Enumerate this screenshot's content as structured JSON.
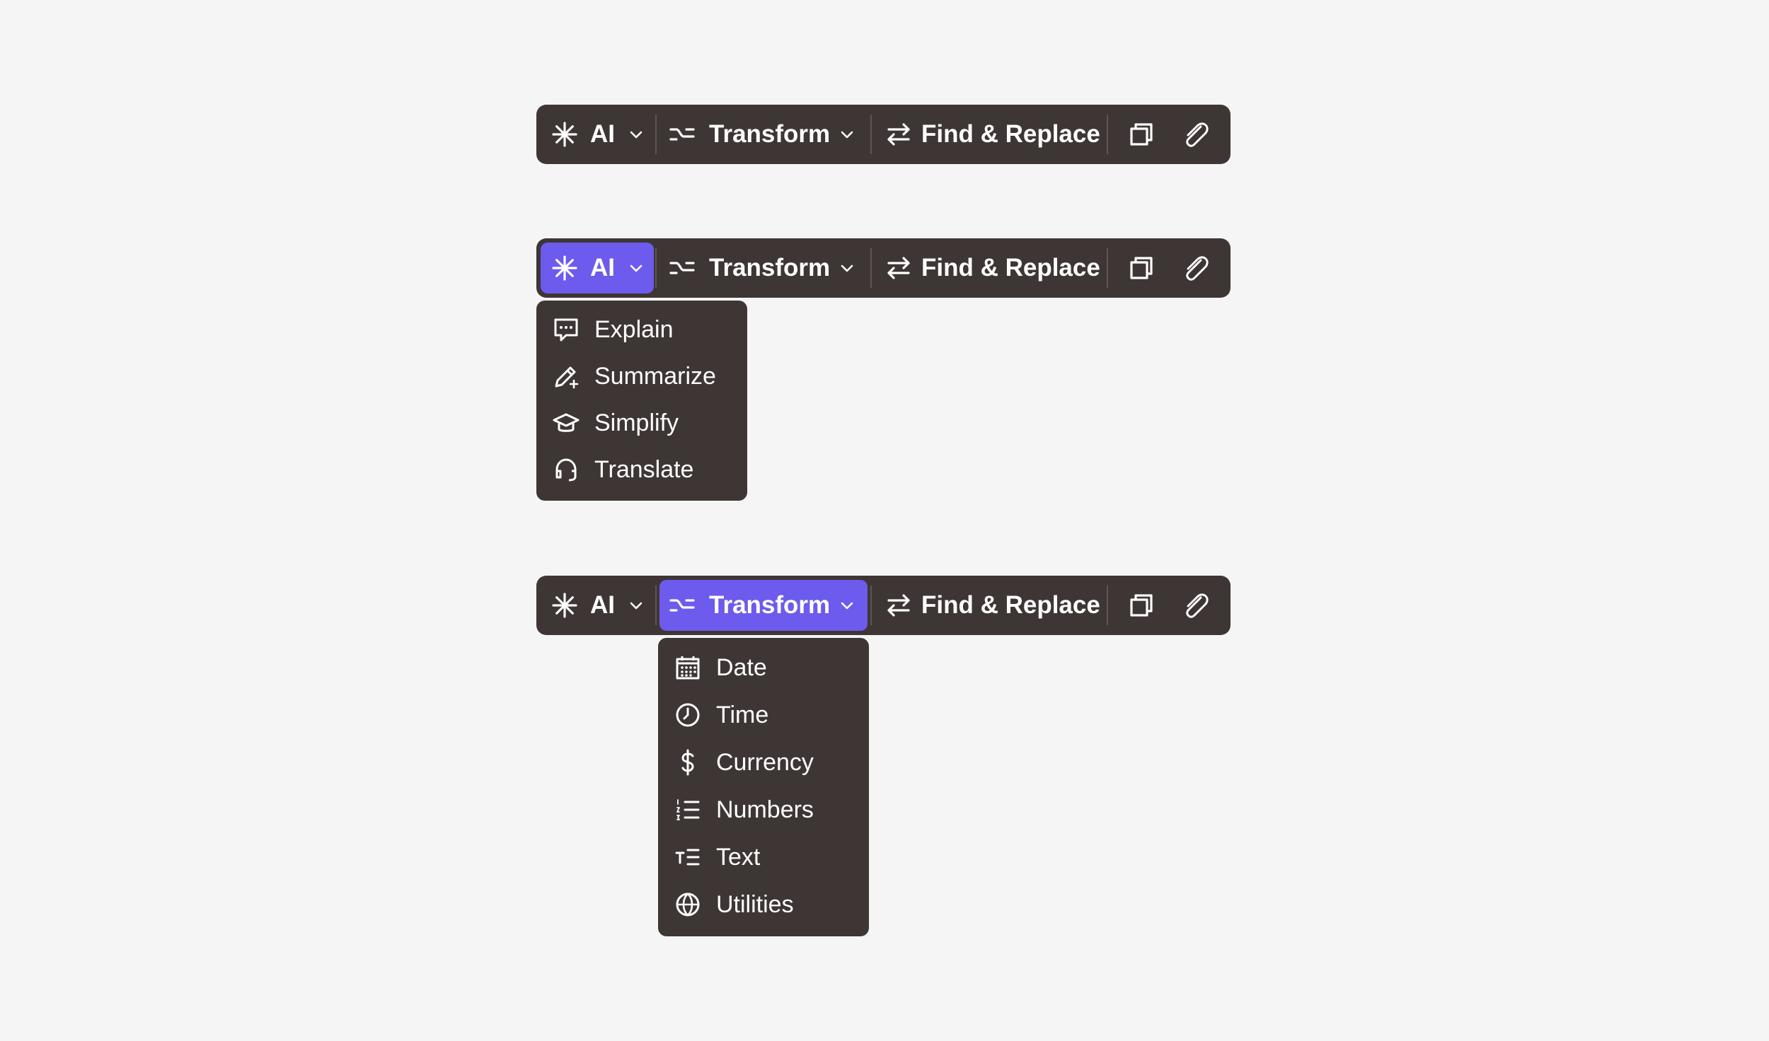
{
  "toolbars": [
    {
      "ai_label": "AI",
      "transform_label": "Transform",
      "find_replace_label": "Find & Replace",
      "active": "none"
    },
    {
      "ai_label": "AI",
      "transform_label": "Transform",
      "find_replace_label": "Find & Replace",
      "active": "ai"
    },
    {
      "ai_label": "AI",
      "transform_label": "Transform",
      "find_replace_label": "Find & Replace",
      "active": "transform"
    }
  ],
  "ai_menu": {
    "items": [
      {
        "label": "Explain",
        "icon": "chat-bubble-icon"
      },
      {
        "label": "Summarize",
        "icon": "pencil-sparkle-icon"
      },
      {
        "label": "Simplify",
        "icon": "graduation-cap-icon"
      },
      {
        "label": "Translate",
        "icon": "headphones-icon"
      }
    ]
  },
  "transform_menu": {
    "items": [
      {
        "label": "Date",
        "icon": "calendar-icon"
      },
      {
        "label": "Time",
        "icon": "clock-icon"
      },
      {
        "label": "Currency",
        "icon": "dollar-icon"
      },
      {
        "label": "Numbers",
        "icon": "numbered-list-icon"
      },
      {
        "label": "Text",
        "icon": "text-format-icon"
      },
      {
        "label": "Utilities",
        "icon": "globe-icon"
      }
    ]
  },
  "colors": {
    "background": "#f5f5f5",
    "toolbar": "#3e3635",
    "accent": "#6d5bed",
    "separator": "#5d5453",
    "text": "#ffffff"
  }
}
